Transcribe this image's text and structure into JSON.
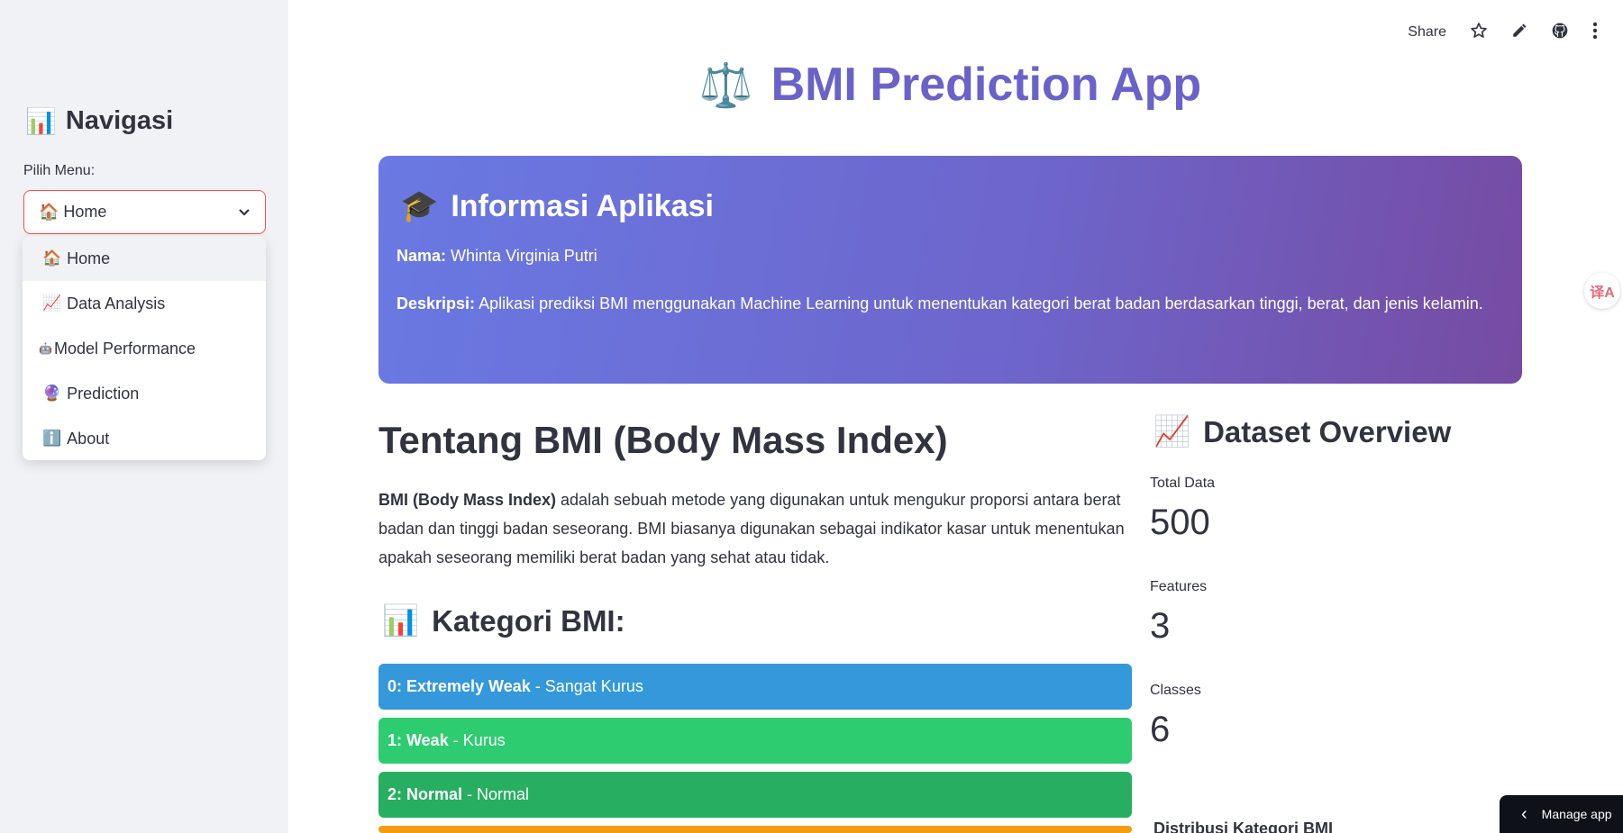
{
  "sidebar": {
    "title_icon": "📊",
    "title": "Navigasi",
    "menu_label": "Pilih Menu:",
    "selected": "🏠 Home",
    "options": [
      {
        "icon": "🏠",
        "label": "Home"
      },
      {
        "icon": "📈",
        "label": "Data Analysis"
      },
      {
        "icon": "🤖",
        "label": "Model Performance"
      },
      {
        "icon": "🔮",
        "label": "Prediction"
      },
      {
        "icon": "ℹ️",
        "label": "About"
      }
    ]
  },
  "toolbar": {
    "share_label": "Share",
    "star_icon": "☆",
    "edit_icon": "✎",
    "github_icon": "●",
    "more_icon": "⋮"
  },
  "main": {
    "title_icon": "⚖️",
    "title": "BMI Prediction App"
  },
  "info": {
    "title_icon": "🎓",
    "title": "Informasi Aplikasi",
    "nama_label": "Nama:",
    "nama_value": "Whinta Virginia Putri",
    "deskripsi_label": "Deskripsi:",
    "deskripsi_value": "Aplikasi prediksi BMI menggunakan Machine Learning untuk menentukan kategori berat badan berdasarkan tinggi, berat, dan jenis kelamin."
  },
  "about_bmi": {
    "title": "Tentang BMI (Body Mass Index)",
    "desc_bold": "BMI (Body Mass Index)",
    "desc_rest": " adalah sebuah metode yang digunakan untuk mengukur proporsi antara berat badan dan tinggi badan seseorang. BMI biasanya digunakan sebagai indikator kasar untuk menentukan apakah seseorang memiliki berat badan yang sehat atau tidak."
  },
  "kategori": {
    "title_icon": "📊",
    "title": "Kategori BMI:",
    "items": [
      {
        "code": "0: Extremely Weak",
        "desc": "- Sangat Kurus",
        "color": "#3498db"
      },
      {
        "code": "1: Weak",
        "desc": "- Kurus",
        "color": "#2ecc71"
      },
      {
        "code": "2: Normal",
        "desc": "- Normal",
        "color": "#27ae60"
      },
      {
        "code": "",
        "desc": "",
        "color": "#f39c12"
      }
    ]
  },
  "dataset": {
    "title_icon": "📈",
    "title": "Dataset Overview",
    "metrics": [
      {
        "label": "Total Data",
        "value": "500"
      },
      {
        "label": "Features",
        "value": "3"
      },
      {
        "label": "Classes",
        "value": "6"
      }
    ],
    "distribution_label": "Distribusi Kategori BMI"
  },
  "manage_app": {
    "icon": "‹",
    "label": "Manage app"
  },
  "translate_icon": "译A"
}
